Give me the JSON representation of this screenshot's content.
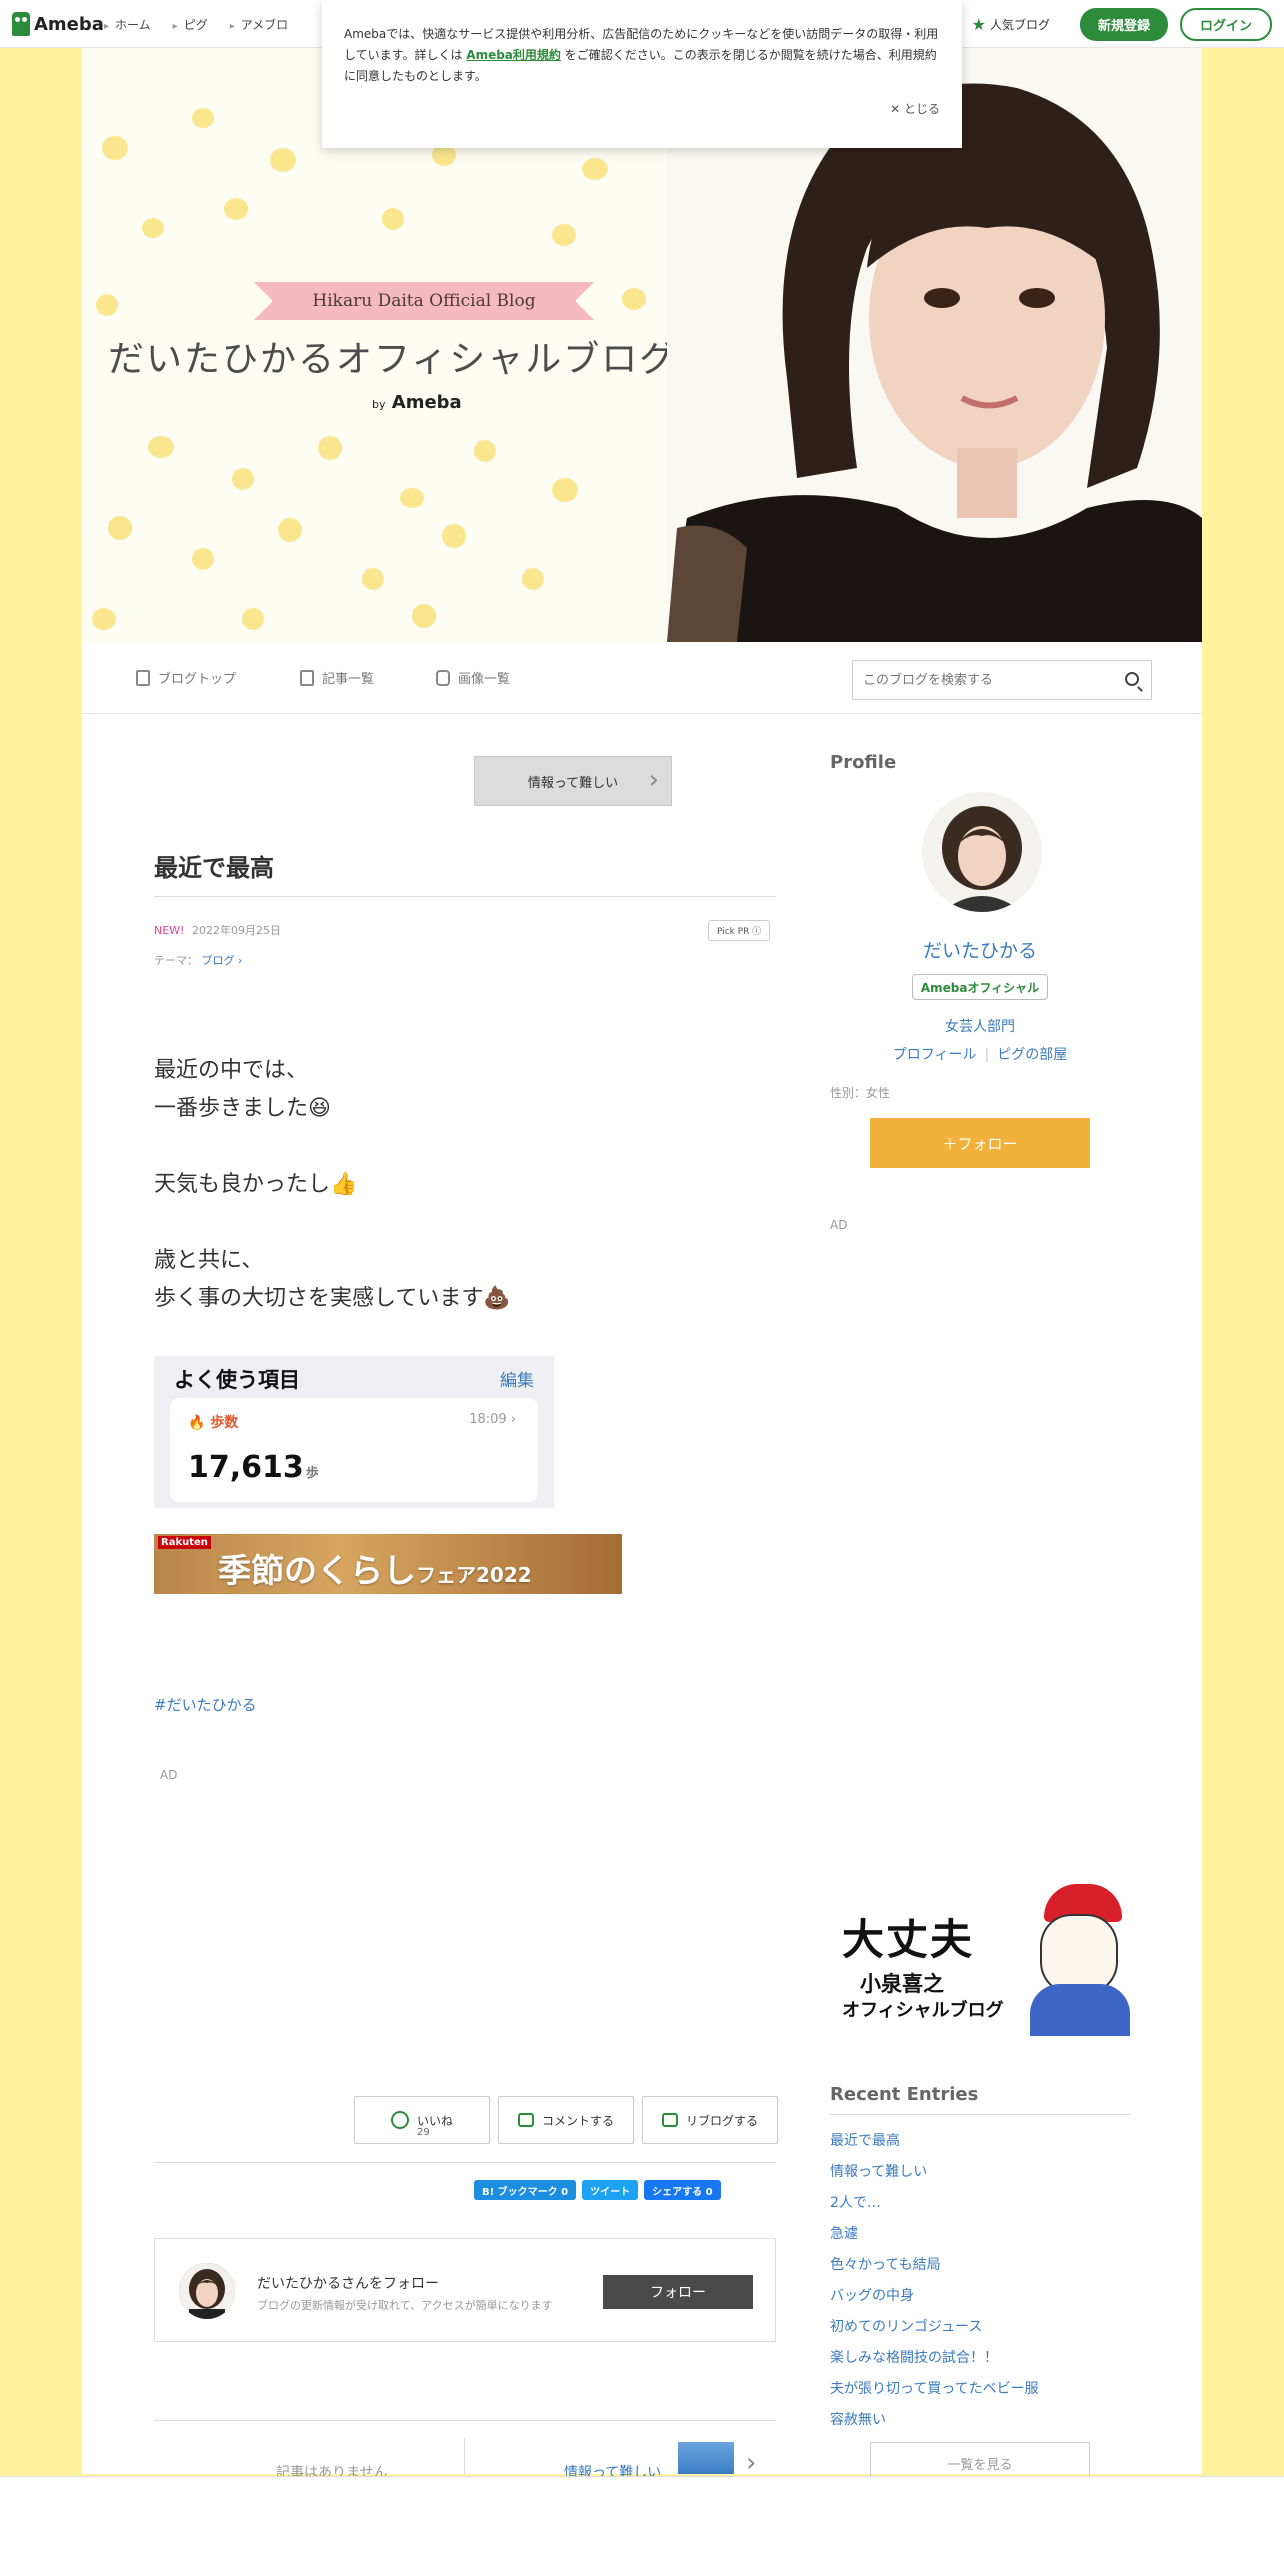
{
  "topbar": {
    "logo": "Ameba",
    "nav": [
      "ホーム",
      "ピグ",
      "アメブロ"
    ],
    "popular": "人気ブログ",
    "register": "新規登録",
    "login": "ログイン"
  },
  "cookie": {
    "text_before": "Amebaでは、快適なサービス提供や利用分析、広告配信のためにクッキーなどを使い訪問データの取得・利用しています。詳しくは",
    "link": "Ameba利用規約",
    "text_after": "をご確認ください。この表示を閉じるか閲覧を続けた場合、利用規約に同意したものとします。",
    "close": "✕ とじる"
  },
  "header": {
    "ribbon": "Hikaru Daita Official Blog",
    "title": "だいたひかるオフィシャルブログ",
    "by": "by",
    "ameba": "Ameba"
  },
  "subnav": {
    "top": "ブログトップ",
    "entries": "記事一覧",
    "images": "画像一覧",
    "search_placeholder": "このブログを検索する"
  },
  "article": {
    "next_label": "情報って難しい",
    "title": "最近で最高",
    "new": "NEW!",
    "date": "2022年09月25日",
    "pickpr": "Pick PR ⓘ",
    "theme_label": "テーマ：",
    "theme": "ブログ ›",
    "lines": [
      "最近の中では、",
      "一番歩きました😆",
      "",
      "天気も良かったし👍",
      "",
      "歳と共に、",
      "歩く事の大切さを実感しています💩"
    ],
    "health": {
      "title": "よく使う項目",
      "edit": "編集",
      "steps_label": "🔥 歩数",
      "time": "18:09",
      "count": "17,613",
      "unit": "歩"
    },
    "banner": {
      "badge": "Rakuten",
      "main": "季節のくらし",
      "sub": "フェア2022"
    },
    "hashtag": "#だいたひかる",
    "ad": "AD",
    "like": "いいね",
    "like_count": "29",
    "comment": "コメントする",
    "reblog": "リブログする",
    "share_hb": "B! ブックマーク 0",
    "share_tw": "ツイート",
    "share_fb": "シェアする 0",
    "follow_title": "だいたひかるさんをフォロー",
    "follow_sub": "ブログの更新情報が受け取れて、アクセスが簡単になります",
    "follow_btn": "フォロー",
    "pager_left": "記事はありません",
    "pager_right": "情報って難しい"
  },
  "sidebar": {
    "profile_heading": "Profile",
    "name": "だいたひかる",
    "badge": "Amebaオフィシャル",
    "category": "女芸人部門",
    "profile_link": "プロフィール",
    "pig_link": "ピグの部屋",
    "gender": "性別：女性",
    "follow": "＋フォロー",
    "ad": "AD",
    "banner": {
      "line1": "大丈夫",
      "line2": "小泉喜之",
      "line3": "オフィシャルブログ"
    },
    "recent_heading": "Recent Entries",
    "recent": [
      "最近で最高",
      "情報って難しい",
      "2人で…",
      "急遽",
      "色々かっても結局",
      "バッグの中身",
      "初めてのリンゴジュース",
      "楽しみな格闘技の試合！！",
      "夫が張り切って買ってたベビー服",
      "容赦無い"
    ],
    "more": "一覧を見る"
  }
}
